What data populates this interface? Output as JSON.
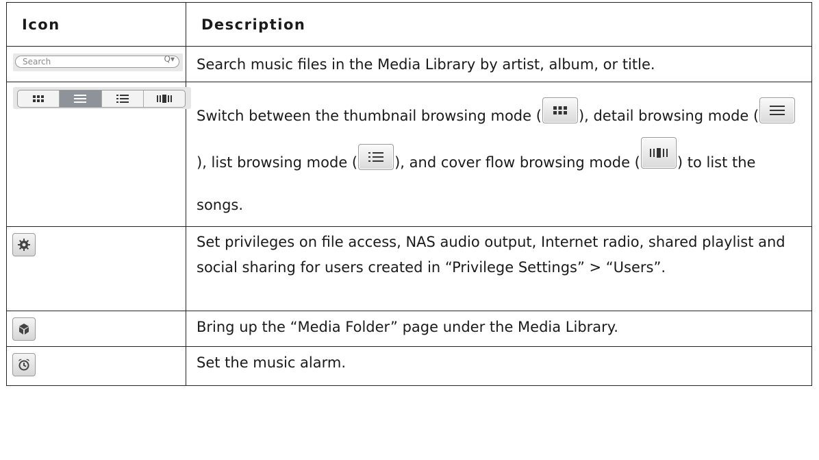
{
  "header": {
    "icon": "Icon",
    "description": "Description"
  },
  "rows": [
    {
      "icon_name": "search-field-icon",
      "search_placeholder": "Search",
      "description": "Search music files in the Media Library by artist, album, or title."
    },
    {
      "icon_name": "view-mode-switch-icon",
      "parts": [
        "Switch between the thumbnail browsing mode (",
        "), detail browsing mode (",
        "), list browsing mode (",
        "), and cover flow browsing mode (",
        ") to list the songs."
      ]
    },
    {
      "icon_name": "gear-icon",
      "description": "Set privileges on file access, NAS audio output, Internet radio, shared playlist and social sharing for users created in “Privilege Settings” > “Users”."
    },
    {
      "icon_name": "cube-icon",
      "description": "Bring up the “Media Folder” page under the Media Library."
    },
    {
      "icon_name": "alarm-clock-icon",
      "description": "Set the music alarm."
    }
  ]
}
